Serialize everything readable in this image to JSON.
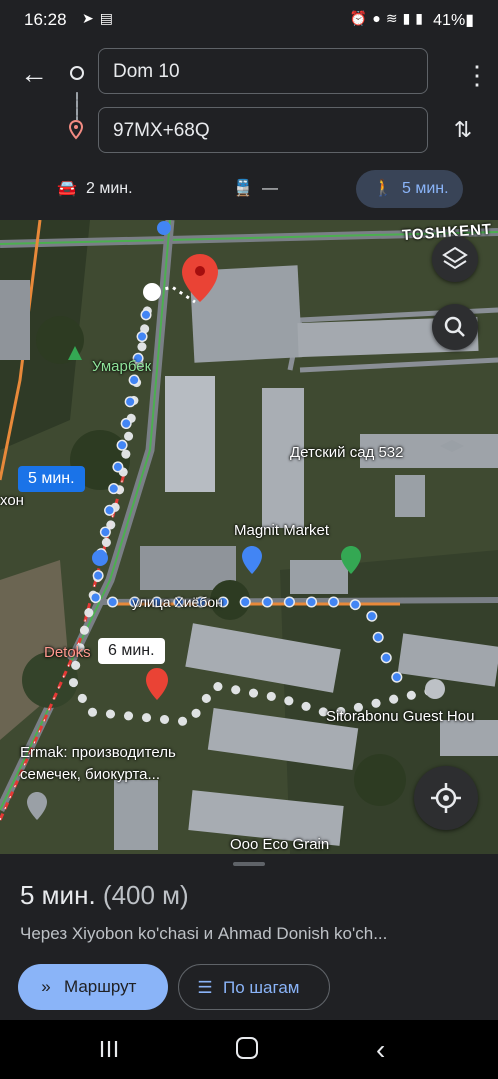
{
  "status_bar": {
    "time": "16:28",
    "battery": "41%",
    "left_icons": [
      "telegram-icon",
      "news-icon"
    ],
    "right_icons": [
      "alarm-icon",
      "location-icon",
      "wifi-icon",
      "signal-icon",
      "signal-icon"
    ]
  },
  "directions": {
    "origin": "Dom 10",
    "destination": "97MX+68Q",
    "modes": [
      {
        "icon": "car-icon",
        "label": "2 мин."
      },
      {
        "icon": "transit-icon",
        "label": "—"
      },
      {
        "icon": "walk-icon",
        "label": "5 мин.",
        "selected": true
      }
    ]
  },
  "map": {
    "labels": {
      "toshkent": "TOSHKENT",
      "umarbek": "Умарбек",
      "kindergarten": "Детский сад 532",
      "magnit": "Magnit Market",
      "street": "улица Хиёбон",
      "detoks": "Detoks",
      "sitorabonu": "Sitorabonu Guest Hou",
      "ermak_1": "Ermak: производитель",
      "ermak_2": "семечек, биокурта...",
      "ooo": "Ooo Eco Grain",
      "xon": "хон"
    },
    "route_tags": {
      "primary": "5 мин.",
      "alternative": "6 мин."
    },
    "colors": {
      "route": "#4285f4",
      "alt_route": "#c4c7c5",
      "pin": "#ea4335"
    }
  },
  "sheet": {
    "duration": "5 мин.",
    "distance": "(400 м)",
    "via": "Через Xiyobon ko'chasi и Ahmad Donish ko'ch...",
    "route_button": "Маршрут",
    "steps_button": "По шагам"
  }
}
